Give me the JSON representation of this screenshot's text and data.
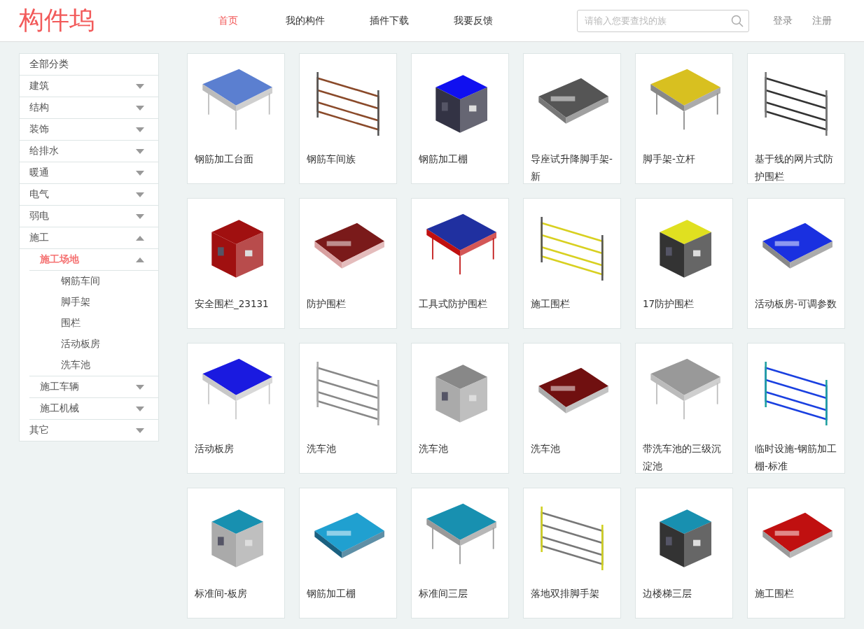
{
  "header": {
    "logo": "构件坞",
    "nav": [
      {
        "label": "首页",
        "selected": true
      },
      {
        "label": "我的构件",
        "selected": false
      },
      {
        "label": "插件下载",
        "selected": false
      },
      {
        "label": "我要反馈",
        "selected": false
      }
    ],
    "search": {
      "placeholder": "请输入您要查找的族"
    },
    "account_links": [
      "登录",
      "注册"
    ]
  },
  "sidebar": {
    "title": "全部分类",
    "items": [
      {
        "label": "建筑",
        "expanded": false,
        "selected": false
      },
      {
        "label": "结构",
        "expanded": false,
        "selected": false
      },
      {
        "label": "装饰",
        "expanded": false,
        "selected": false
      },
      {
        "label": "给排水",
        "expanded": false,
        "selected": false
      },
      {
        "label": "暖通",
        "expanded": false,
        "selected": false
      },
      {
        "label": "电气",
        "expanded": false,
        "selected": false
      },
      {
        "label": "弱电",
        "expanded": false,
        "selected": false
      },
      {
        "label": "施工",
        "expanded": true,
        "selected": false,
        "children": [
          {
            "label": "施工场地",
            "expanded": true,
            "selected": true,
            "children": [
              {
                "label": "钢筋车间"
              },
              {
                "label": "脚手架"
              },
              {
                "label": "围栏"
              },
              {
                "label": "活动板房"
              },
              {
                "label": "洗车池"
              }
            ]
          },
          {
            "label": "施工车辆",
            "expanded": false,
            "selected": false
          },
          {
            "label": "施工机械",
            "expanded": false,
            "selected": false
          }
        ]
      },
      {
        "label": "其它",
        "expanded": false,
        "selected": false
      }
    ]
  },
  "cards": [
    {
      "title": "钢筋加工台面",
      "kind": "picture"
    },
    {
      "title": "钢筋车间族",
      "kind": "picture"
    },
    {
      "title": "钢筋加工棚",
      "kind": "picture"
    },
    {
      "title": "导座试升降脚手架-新",
      "kind": "picture"
    },
    {
      "title": "脚手架-立杆",
      "kind": "picture"
    },
    {
      "title": "基于线的网片式防护围栏",
      "kind": "picture"
    },
    {
      "title": "安全围栏_23131",
      "kind": "picture"
    },
    {
      "title": "防护围栏",
      "kind": "picture"
    },
    {
      "title": "工具式防护围栏",
      "kind": "picture"
    },
    {
      "title": "施工围栏",
      "kind": "picture"
    },
    {
      "title": "17防护围栏",
      "kind": "picture"
    },
    {
      "title": "活动板房-可调参数",
      "kind": "picture"
    },
    {
      "title": "活动板房",
      "kind": "picture"
    },
    {
      "title": "洗车池",
      "kind": "picture"
    },
    {
      "title": "洗车池",
      "kind": "picture"
    },
    {
      "title": "洗车池",
      "kind": "picture"
    },
    {
      "title": "带洗车池的三级沉淀池",
      "kind": "picture"
    },
    {
      "title": "临时设施-钢筋加工棚-标准",
      "kind": "picture"
    },
    {
      "title": "标准间-板房",
      "kind": "picture"
    },
    {
      "title": "钢筋加工棚",
      "kind": "picture"
    },
    {
      "title": "标准间三层",
      "kind": "picture"
    },
    {
      "title": "落地双排脚手架",
      "kind": "picture"
    },
    {
      "title": "边楼梯三层",
      "kind": "picture"
    },
    {
      "title": "施工围栏",
      "kind": "picture"
    }
  ]
}
